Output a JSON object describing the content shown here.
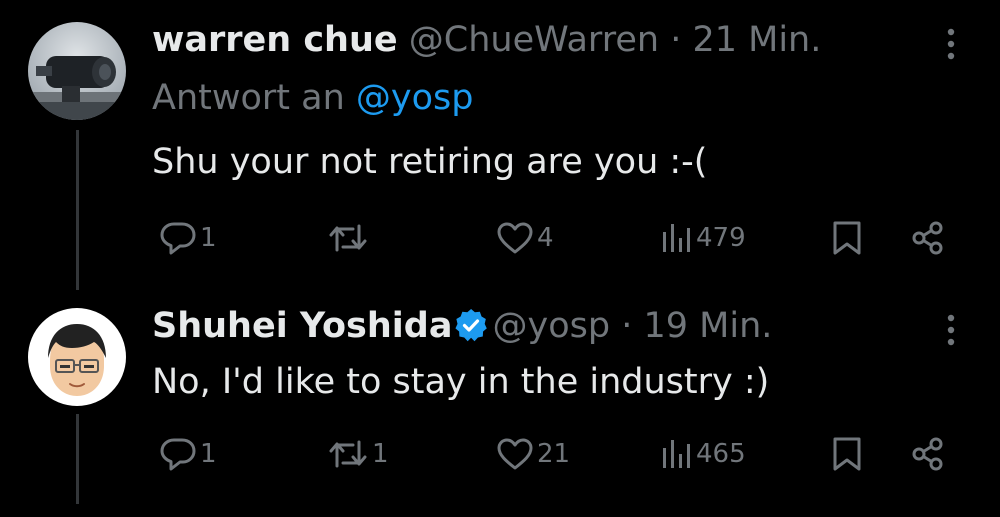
{
  "tweets": [
    {
      "name": "warren chue",
      "handle": "@ChueWarren",
      "separator": "·",
      "time": "21 Min.",
      "reply_prefix": "Antwort an",
      "reply_handle": "@yosp",
      "text": "Shu your not retiring are you :-(",
      "verified": false,
      "avatar_icon": "binoculars-photo-avatar",
      "actions": {
        "reply_count": "1",
        "retweet_count": "",
        "like_count": "4",
        "view_count": "479"
      }
    },
    {
      "name": "Shuhei Yoshida",
      "handle": "@yosp",
      "separator": "·",
      "time": "19 Min.",
      "text": "No, I'd like to stay in the industry :)",
      "verified": true,
      "avatar_icon": "cartoon-face-avatar",
      "actions": {
        "reply_count": "1",
        "retweet_count": "1",
        "like_count": "21",
        "view_count": "465"
      }
    }
  ],
  "colors": {
    "background": "#000000",
    "primary_text": "#e7e9ea",
    "secondary_text": "#71767b",
    "accent": "#1d9bf0",
    "thread_line": "#333639"
  },
  "icons": [
    "reply-icon",
    "retweet-icon",
    "like-icon",
    "views-icon",
    "bookmark-icon",
    "share-icon",
    "more-options-icon",
    "verified-badge-icon"
  ]
}
